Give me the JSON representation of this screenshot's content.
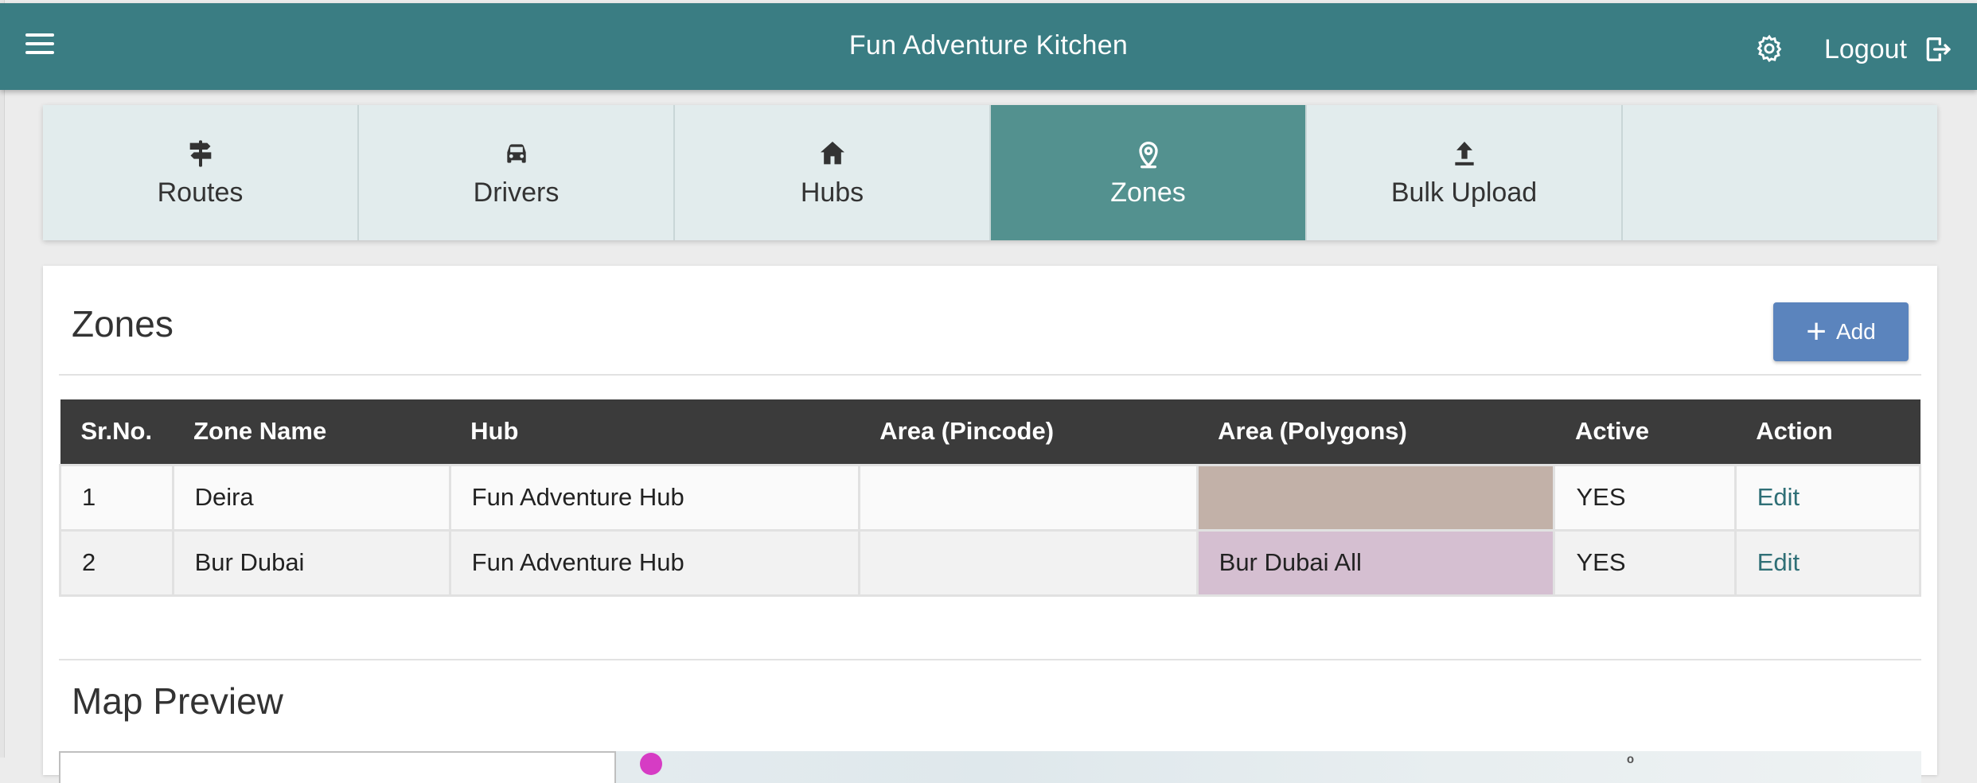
{
  "header": {
    "title": "Fun Adventure Kitchen",
    "logout_label": "Logout",
    "icons": [
      "menu-icon",
      "gear-icon",
      "logout-icon"
    ]
  },
  "tabs": [
    {
      "label": "Routes",
      "icon": "signpost-icon"
    },
    {
      "label": "Drivers",
      "icon": "car-icon"
    },
    {
      "label": "Hubs",
      "icon": "home-icon"
    },
    {
      "label": "Zones",
      "icon": "map-pin-icon",
      "active": true
    },
    {
      "label": "Bulk Upload",
      "icon": "upload-icon"
    }
  ],
  "zones": {
    "title": "Zones",
    "add_label": "Add",
    "columns": [
      "Sr.No.",
      "Zone Name",
      "Hub",
      "Area (Pincode)",
      "Area (Polygons)",
      "Active",
      "Action"
    ],
    "rows": [
      {
        "sr": "1",
        "zone_name": "Deira",
        "hub": "Fun Adventure Hub",
        "pincode": "",
        "polygons": "",
        "polygon_color": "#c2b1a8",
        "active": "YES",
        "action": "Edit"
      },
      {
        "sr": "2",
        "zone_name": "Bur Dubai",
        "hub": "Fun Adventure Hub",
        "pincode": "",
        "polygons": "Bur Dubai All",
        "polygon_color": "#d5bfd1",
        "active": "YES",
        "action": "Edit"
      }
    ]
  },
  "map": {
    "title": "Map Preview",
    "label": "ᵒ"
  },
  "colors": {
    "topbar": "#3a7d83",
    "active_tab": "#53918f",
    "add_button": "#5b84bd",
    "table_header": "#3b3b3b"
  }
}
